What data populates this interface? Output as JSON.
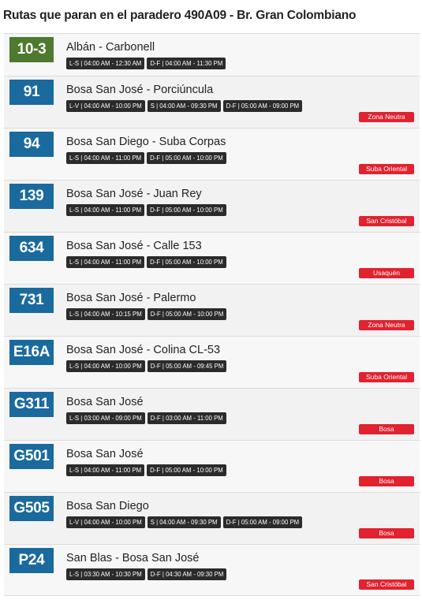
{
  "page_title": "Rutas que paran en el paradero 490A09 - Br. Gran Colombiano",
  "routes": [
    {
      "code": "10-3",
      "color": "#4d7a2f",
      "name": "Albán - Carbonell",
      "schedules": [
        "L-S | 04:00 AM - 12:30 AM",
        "D-F | 04:00 AM - 11:30 PM"
      ],
      "zone": ""
    },
    {
      "code": "91",
      "color": "#1a6a9e",
      "name": "Bosa San José - Porciúncula",
      "schedules": [
        "L-V | 04:00 AM - 10:00 PM",
        "S | 04:00 AM - 09:30 PM",
        "D-F | 05:00 AM - 09:00 PM"
      ],
      "zone": "Zona Neutra"
    },
    {
      "code": "94",
      "color": "#1a6a9e",
      "name": "Bosa San Diego - Suba Corpas",
      "schedules": [
        "L-S | 04:00 AM - 11:00 PM",
        "D-F | 05:00 AM - 10:00 PM"
      ],
      "zone": "Suba Oriental"
    },
    {
      "code": "139",
      "color": "#1a6a9e",
      "name": "Bosa San José - Juan Rey",
      "schedules": [
        "L-S | 04:00 AM - 11:00 PM",
        "D-F | 05:00 AM - 10:00 PM"
      ],
      "zone": "San Cristóbal"
    },
    {
      "code": "634",
      "color": "#1a6a9e",
      "name": "Bosa San José - Calle 153",
      "schedules": [
        "L-S | 04:00 AM - 11:00 PM",
        "D-F | 05:00 AM - 10:00 PM"
      ],
      "zone": "Usaquén"
    },
    {
      "code": "731",
      "color": "#1a6a9e",
      "name": "Bosa San José - Palermo",
      "schedules": [
        "L-S | 04:00 AM - 10:15 PM",
        "D-F | 05:00 AM - 10:00 PM"
      ],
      "zone": "Zona Neutra"
    },
    {
      "code": "E16A",
      "color": "#1a6a9e",
      "name": "Bosa San José - Colina CL-53",
      "schedules": [
        "L-S | 04:00 AM - 10:00 PM",
        "D-F | 05:00 AM - 09:45 PM"
      ],
      "zone": "Suba Oriental"
    },
    {
      "code": "G311",
      "color": "#1a6a9e",
      "name": "Bosa San José",
      "schedules": [
        "L-S | 03:00 AM - 09:00 PM",
        "D-F | 03:00 AM - 11:00 PM"
      ],
      "zone": "Bosa"
    },
    {
      "code": "G501",
      "color": "#1a6a9e",
      "name": "Bosa San José",
      "schedules": [
        "L-S | 04:00 AM - 11:00 PM",
        "D-F | 05:00 AM - 10:00 PM"
      ],
      "zone": "Bosa"
    },
    {
      "code": "G505",
      "color": "#1a6a9e",
      "name": "Bosa San Diego",
      "schedules": [
        "L-V | 04:00 AM - 10:00 PM",
        "S | 04:00 AM - 09:30 PM",
        "D-F | 05:00 AM - 09:00 PM"
      ],
      "zone": "Bosa"
    },
    {
      "code": "P24",
      "color": "#1a6a9e",
      "name": "San Blas - Bosa San José",
      "schedules": [
        "L-S | 03:30 AM - 10:30 PM",
        "D-F | 04:30 AM - 09:30 PM"
      ],
      "zone": "San Cristóbal"
    }
  ]
}
